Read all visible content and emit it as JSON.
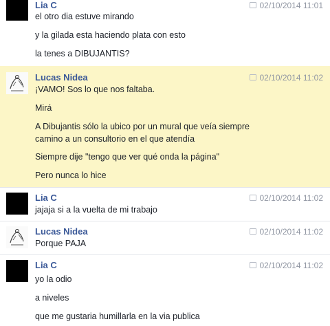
{
  "messages": [
    {
      "author": "Lia C",
      "timestamp": "02/10/2014 11:01",
      "avatar": "black-square",
      "lines": [
        "el otro dia estuve mirando",
        "y la gilada esta haciendo plata con esto",
        "la tenes a DIBUJANTIS?"
      ]
    },
    {
      "author": "Lucas Nidea",
      "timestamp": "02/10/2014 11:02",
      "avatar": "sketch-drawing",
      "highlighted": true,
      "lines": [
        "¡VAMO! Sos lo que nos faltaba.",
        "Mirá",
        "A Dibujantis sólo la ubico por un mural que veía siempre",
        "camino a un consultorio en el que atendía",
        "Siempre dije \"tengo que ver qué onda la página\"",
        "Pero nunca lo hice"
      ]
    },
    {
      "author": "Lia C",
      "timestamp": "02/10/2014 11:02",
      "avatar": "black-square",
      "lines": [
        "jajaja si a la vuelta de mi trabajo"
      ]
    },
    {
      "author": "Lucas Nidea",
      "timestamp": "02/10/2014 11:02",
      "avatar": "sketch-drawing",
      "lines": [
        "Porque PAJA"
      ]
    },
    {
      "author": "Lia C",
      "timestamp": "02/10/2014 11:02",
      "avatar": "black-square",
      "lines": [
        "yo la odio",
        "a niveles",
        "que me gustaria humillarla en la via publica"
      ]
    }
  ],
  "colors": {
    "author": "#3b5998",
    "timestamp": "#9197a3",
    "highlight": "#fcf6c7"
  }
}
